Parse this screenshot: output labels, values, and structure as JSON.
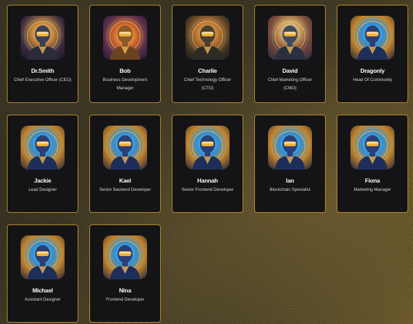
{
  "members": [
    {
      "name": "Dr.Smith",
      "role": "Chief Executive Officer (CEO)",
      "avatar_icon": "robot-executive-avatar",
      "theme": "exec"
    },
    {
      "name": "Bob",
      "role": "Business Development Manager",
      "avatar_icon": "robot-gold-armor-avatar",
      "theme": "bob"
    },
    {
      "name": "Charlie",
      "role": "Chief Technology Officer (CTO)",
      "avatar_icon": "robot-suit-avatar",
      "theme": "charlie"
    },
    {
      "name": "David",
      "role": "Chief Marketing Officer (CMO)",
      "avatar_icon": "robot-jacket-avatar",
      "theme": "david"
    },
    {
      "name": "Dragonly",
      "role": "Head Of Community",
      "avatar_icon": "robot-blue-helmet-avatar",
      "theme": "generic"
    },
    {
      "name": "Jackie",
      "role": "Lead Designer",
      "avatar_icon": "robot-blue-helmet-avatar",
      "theme": "generic"
    },
    {
      "name": "Kael",
      "role": "Senior Backend Developer",
      "avatar_icon": "robot-blue-helmet-avatar",
      "theme": "generic"
    },
    {
      "name": "Hannah",
      "role": "Senior Frontend Developer",
      "avatar_icon": "robot-blue-helmet-avatar",
      "theme": "generic"
    },
    {
      "name": "Ian",
      "role": "Blockchain Specialist",
      "avatar_icon": "robot-blue-helmet-avatar",
      "theme": "generic"
    },
    {
      "name": "Fiona",
      "role": "Marketing Manager",
      "avatar_icon": "robot-blue-helmet-avatar",
      "theme": "generic"
    },
    {
      "name": "Michael",
      "role": "Assistant Designer",
      "avatar_icon": "robot-blue-helmet-avatar",
      "theme": "generic"
    },
    {
      "name": "Nina",
      "role": "Frontend Developer",
      "avatar_icon": "robot-blue-helmet-avatar",
      "theme": "generic"
    }
  ],
  "colors": {
    "card_background": "#141416",
    "card_border": "#b98a2e",
    "name_text": "#ffffff",
    "role_text": "#d9d9d9"
  }
}
